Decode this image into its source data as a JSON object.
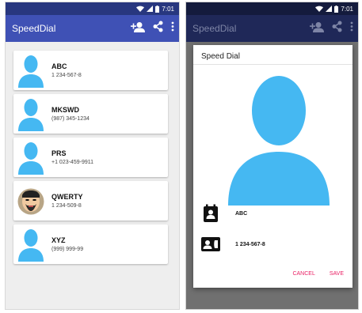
{
  "status_bar": {
    "time": "7:01"
  },
  "app": {
    "title": "SpeedDial",
    "actions": [
      "add-contact-icon",
      "share-icon",
      "more-vert-icon"
    ]
  },
  "contacts": [
    {
      "name": "ABC",
      "number": "1 234-567-8",
      "avatar": "person-silhouette"
    },
    {
      "name": "MKSWD",
      "number": "(987) 345-1234",
      "avatar": "person-silhouette"
    },
    {
      "name": "PRS",
      "number": "+1 023-459-9911",
      "avatar": "person-silhouette"
    },
    {
      "name": "QWERTY",
      "number": "1 234-509-8",
      "avatar": "photo"
    },
    {
      "name": "XYZ",
      "number": "(999) 999-99",
      "avatar": "person-silhouette"
    }
  ],
  "dialog": {
    "title": "Speed Dial",
    "name_value": "ABC",
    "number_value": "1 234-567-8",
    "cancel_label": "CANCEL",
    "save_label": "SAVE"
  },
  "colors": {
    "primary": "#3f51b5",
    "primary_dark": "#28377f",
    "avatar": "#4fc3f7",
    "accent": "#e91e63"
  }
}
